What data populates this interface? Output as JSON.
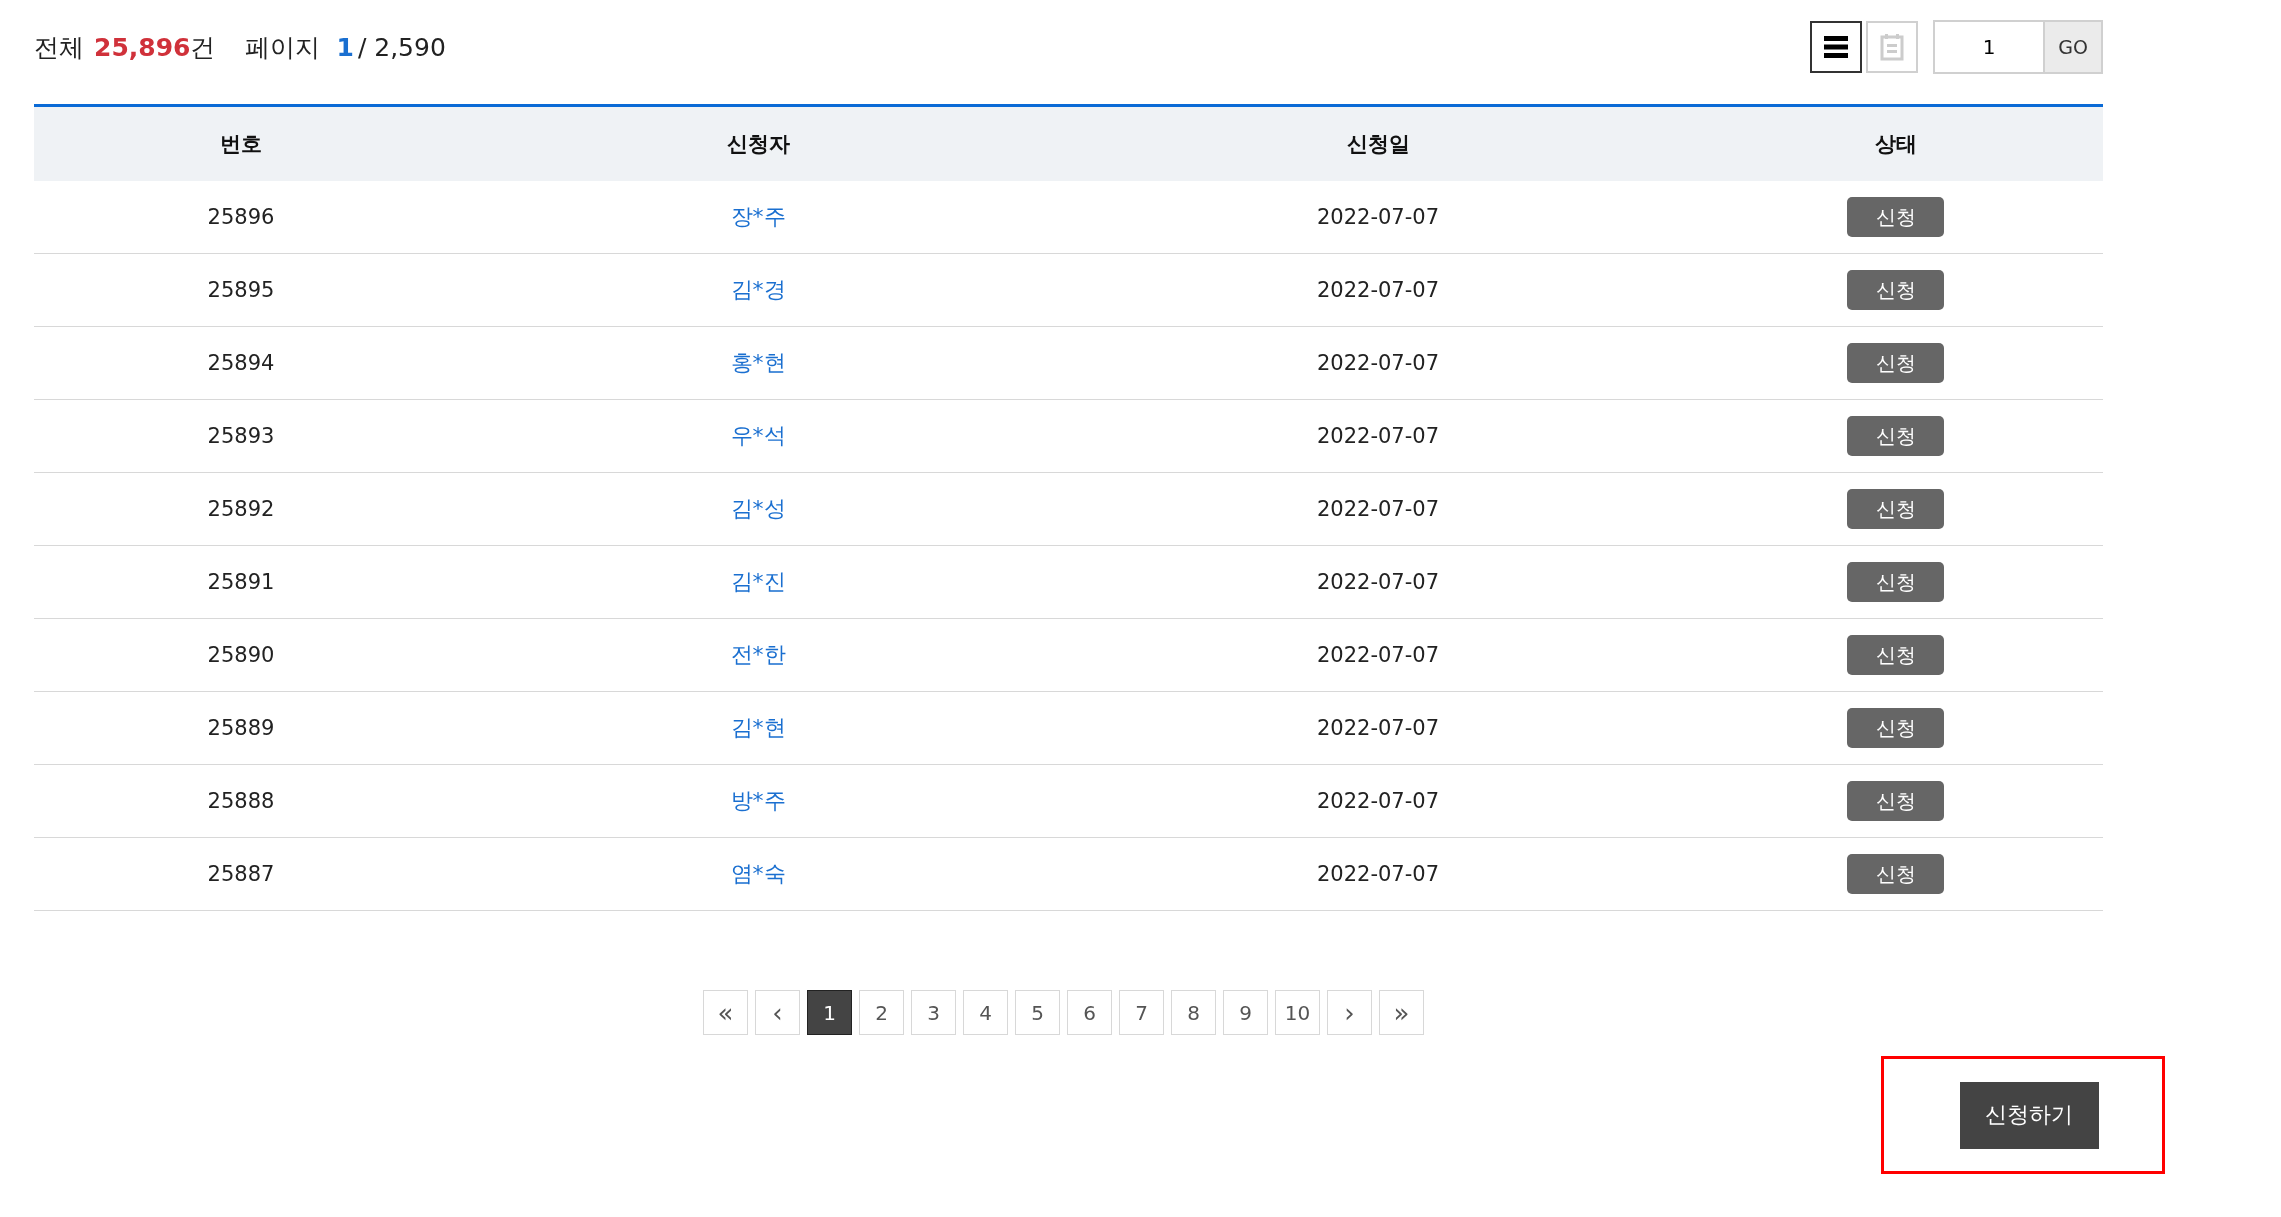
{
  "summary": {
    "total_label": "전체",
    "total_count": "25,896",
    "total_unit": "건",
    "page_label": "페이지",
    "current_page": "1",
    "page_total": "/ 2,590"
  },
  "view_buttons": [
    {
      "kind": "list",
      "selected": true
    },
    {
      "kind": "card",
      "selected": false
    }
  ],
  "page_jump": {
    "value": "1",
    "button": "GO"
  },
  "table": {
    "columns": [
      "번호",
      "신청자",
      "신청일",
      "상태"
    ],
    "rows": [
      {
        "number": "25896",
        "applicant": "장*주",
        "date": "2022-07-07",
        "status": "신청"
      },
      {
        "number": "25895",
        "applicant": "김*경",
        "date": "2022-07-07",
        "status": "신청"
      },
      {
        "number": "25894",
        "applicant": "홍*현",
        "date": "2022-07-07",
        "status": "신청"
      },
      {
        "number": "25893",
        "applicant": "우*석",
        "date": "2022-07-07",
        "status": "신청"
      },
      {
        "number": "25892",
        "applicant": "김*성",
        "date": "2022-07-07",
        "status": "신청"
      },
      {
        "number": "25891",
        "applicant": "김*진",
        "date": "2022-07-07",
        "status": "신청"
      },
      {
        "number": "25890",
        "applicant": "전*한",
        "date": "2022-07-07",
        "status": "신청"
      },
      {
        "number": "25889",
        "applicant": "김*현",
        "date": "2022-07-07",
        "status": "신청"
      },
      {
        "number": "25888",
        "applicant": "방*주",
        "date": "2022-07-07",
        "status": "신청"
      },
      {
        "number": "25887",
        "applicant": "염*숙",
        "date": "2022-07-07",
        "status": "신청"
      }
    ]
  },
  "pagination": [
    {
      "label": "«",
      "kind": "first",
      "selected": false
    },
    {
      "label": "‹",
      "kind": "prev",
      "selected": false
    },
    {
      "label": "1",
      "kind": "page",
      "selected": true
    },
    {
      "label": "2",
      "kind": "page",
      "selected": false
    },
    {
      "label": "3",
      "kind": "page",
      "selected": false
    },
    {
      "label": "4",
      "kind": "page",
      "selected": false
    },
    {
      "label": "5",
      "kind": "page",
      "selected": false
    },
    {
      "label": "6",
      "kind": "page",
      "selected": false
    },
    {
      "label": "7",
      "kind": "page",
      "selected": false
    },
    {
      "label": "8",
      "kind": "page",
      "selected": false
    },
    {
      "label": "9",
      "kind": "page",
      "selected": false
    },
    {
      "label": "10",
      "kind": "page",
      "selected": false
    },
    {
      "label": "›",
      "kind": "next",
      "selected": false
    },
    {
      "label": "»",
      "kind": "last",
      "selected": false
    }
  ],
  "apply_button": {
    "label": "신청하기",
    "highlighted": true
  }
}
